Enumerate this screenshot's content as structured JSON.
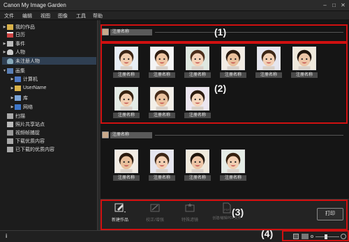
{
  "window": {
    "title": "Canon My Image Garden",
    "min_glyph": "–",
    "max_glyph": "□",
    "close_glyph": "✕"
  },
  "menu": [
    "文件",
    "编辑",
    "视图",
    "图像",
    "工具",
    "帮助"
  ],
  "sidebar": {
    "items": [
      {
        "label": "我的作品",
        "arrow": "▶",
        "icon": "folder-icon"
      },
      {
        "label": "日历",
        "arrow": "",
        "icon": "calendar-icon"
      },
      {
        "label": "事件",
        "arrow": "▶",
        "icon": "event-icon"
      },
      {
        "label": "人物",
        "arrow": "▶",
        "icon": "person-icon"
      },
      {
        "label": "未注册人物",
        "arrow": "",
        "icon": "unregistered-person-icon",
        "selected": true
      },
      {
        "label": "画集",
        "arrow": "▼",
        "icon": "album-icon"
      },
      {
        "label": "计算机",
        "arrow": "▶",
        "icon": "computer-icon"
      },
      {
        "label": "UserName",
        "arrow": "▶",
        "icon": "user-folder-icon"
      },
      {
        "label": "库",
        "arrow": "▶",
        "icon": "library-icon"
      },
      {
        "label": "网络",
        "arrow": "▶",
        "icon": "network-icon"
      },
      {
        "label": "扫描",
        "arrow": "",
        "icon": "scan-icon"
      },
      {
        "label": "照片共享站点",
        "arrow": "",
        "icon": "photo-share-icon"
      },
      {
        "label": "视频帧捕捉",
        "arrow": "",
        "icon": "video-capture-icon"
      },
      {
        "label": "下载优质内容",
        "arrow": "",
        "icon": "download-icon"
      },
      {
        "label": "已下载的优质内容",
        "arrow": "",
        "icon": "downloaded-icon"
      }
    ]
  },
  "groups": [
    {
      "header_label": "注册名称",
      "thumb_label": "注册名称",
      "count": 9
    },
    {
      "header_label": "注册名称",
      "thumb_label": "注册名称",
      "count": 4
    }
  ],
  "callouts": [
    "(1)",
    "(2)",
    "(3)",
    "(4)"
  ],
  "toolbar": {
    "new_art": "新建作品",
    "correct_enhance": "校正/增强",
    "special_filters": "特殊滤镜",
    "create_edit_pdf": "创建/编辑PDF文件",
    "print": "打印"
  },
  "statusbar": {
    "info_glyph": "i",
    "zoom_level": 0.45
  },
  "colors": {
    "callout": "#d01010",
    "selected": "#2f3f52",
    "background": "#151515"
  }
}
